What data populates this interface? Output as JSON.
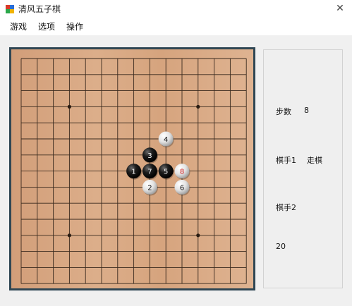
{
  "window": {
    "title": "清风五子棋",
    "close_symbol": "✕"
  },
  "menu": {
    "items": [
      "游戏",
      "选项",
      "操作"
    ]
  },
  "board": {
    "size": 15,
    "star_points": [
      [
        3,
        3
      ],
      [
        11,
        3
      ],
      [
        3,
        11
      ],
      [
        11,
        11
      ]
    ],
    "stones": [
      {
        "n": "1",
        "color": "black",
        "col": 7,
        "row": 7
      },
      {
        "n": "2",
        "color": "white",
        "col": 8,
        "row": 8
      },
      {
        "n": "3",
        "color": "black",
        "col": 8,
        "row": 6
      },
      {
        "n": "4",
        "color": "white",
        "col": 9,
        "row": 5
      },
      {
        "n": "5",
        "color": "black",
        "col": 9,
        "row": 7
      },
      {
        "n": "6",
        "color": "white",
        "col": 10,
        "row": 8
      },
      {
        "n": "7",
        "color": "black",
        "col": 8,
        "row": 7
      },
      {
        "n": "8",
        "color": "white",
        "col": 10,
        "row": 7,
        "last": true
      }
    ]
  },
  "panel": {
    "steps_label": "步数",
    "steps_value": "8",
    "player1_label": "棋手1",
    "player1_status": "走棋",
    "player2_label": "棋手2",
    "timer_value": "20"
  },
  "colors": {
    "board_wood": "#d6a47e",
    "frame": "#2f4653",
    "last_move_number": "#d01818"
  }
}
